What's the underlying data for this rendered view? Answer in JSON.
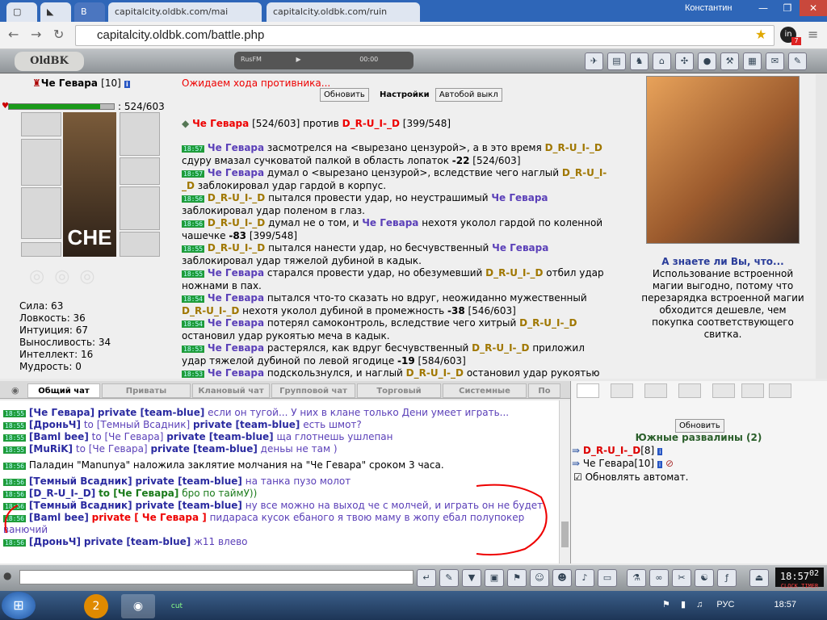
{
  "browser": {
    "tabs": [
      {
        "label": "capitalcity.oldbk.com/mai"
      },
      {
        "label": "capitalcity.oldbk.com/ruin"
      }
    ],
    "user": "Константин",
    "url": "capitalcity.oldbk.com/battle.php",
    "ext_badge": "7"
  },
  "gamebar": {
    "logo": "OldBK",
    "radio_label": "RusFM",
    "radio_time": "00:00"
  },
  "character": {
    "name": "Че Гевара",
    "level": "[10]",
    "hp": "524/603",
    "hp_fraction": 0.869,
    "photo_caption": "CHE",
    "stats": [
      "Сила: 63",
      "Ловкость: 36",
      "Интуиция: 67",
      "Выносливость: 34",
      "Интеллект: 16",
      "Мудрость: 0"
    ]
  },
  "battle": {
    "status": "Ожидаем хода противника...",
    "refresh": "Обновить",
    "settings": "Настройки",
    "autobattle": "Автобой выкл",
    "player1": "Че Гевара",
    "player1_hp": "[524/603]",
    "versus": "против",
    "player2": "D_R-U_I-_D",
    "player2_hp": "[399/548]",
    "log": [
      {
        "time": "18:57",
        "html": "<span class=p1>Че Гевара</span> засмотрелся на &lt;вырезано цензурой&gt;, а в это время <span class=p2>D_R-U_I-_D</span> сдуру вмазал сучковатой палкой в область лопаток <b>-22</b> [524/603]"
      },
      {
        "time": "18:57",
        "html": "<span class=p1>Че Гевара</span> думал о &lt;вырезано цензурой&gt;, вследствие чего наглый <span class=p2>D_R-U_I-_D</span> заблокировал удар гардой в корпус."
      },
      {
        "time": "18:56",
        "html": "<span class=p2>D_R-U_I-_D</span> пытался провести удар, но неустрашимый <span class=p1>Че Гевара</span> заблокировал удар поленом в глаз."
      },
      {
        "time": "18:56",
        "html": "<span class=p2>D_R-U_I-_D</span> думал не о том, и <span class=p1>Че Гевара</span> нехотя уколол гардой по коленной чашечке <b>-83</b> [399/548]"
      },
      {
        "time": "18:55",
        "html": "<span class=p2>D_R-U_I-_D</span> пытался нанести удар, но бесчувственный <span class=p1>Че Гевара</span> заблокировал удар тяжелой дубиной в кадык."
      },
      {
        "time": "18:55",
        "html": "<span class=p1>Че Гевара</span> старался провести удар, но обезумевший <span class=p2>D_R-U_I-_D</span> отбил удар ножнами в пах."
      },
      {
        "time": "18:54",
        "html": "<span class=p1>Че Гевара</span> пытался что-то сказать но вдруг, неожиданно мужественный <span class=p2>D_R-U_I-_D</span> нехотя уколол дубиной в промежность <b>-38</b> [546/603]"
      },
      {
        "time": "18:54",
        "html": "<span class=p1>Че Гевара</span> потерял самоконтроль, вследствие чего хитрый <span class=p2>D_R-U_I-_D</span> остановил удар рукоятью меча в кадык."
      },
      {
        "time": "18:53",
        "html": "<span class=p1>Че Гевара</span> растерялся, как вдруг бесчувственный <span class=p2>D_R-U_I-_D</span> приложил удар тяжелой дубиной по левой ягодице <b>-19</b> [584/603]"
      },
      {
        "time": "18:53",
        "html": "<span class=p1>Че Гевара</span> подскользнулся, и наглый <span class=p2>D_R-U_I-_D</span> остановил удар рукоятью меча по ногам."
      }
    ]
  },
  "tips": {
    "title": "А знаете ли Вы, что...",
    "text": "Использование встроенной магии выгодно, потому что перезарядка встроенной магии обходится дешевле, чем покупка соответствующего свитка."
  },
  "chat_tabs": [
    "Общий чат",
    "Приваты",
    "Клановый чат",
    "Групповой чат",
    "Торговый",
    "Системные",
    "По"
  ],
  "chat": [
    {
      "time": "18:55",
      "html": "<span class=nm>[Че Гевара]</span> <span class=pr>private [team-blue]</span> <span class=pv>если он тугой... У них в клане только Дени умеет играть...</span>"
    },
    {
      "time": "18:55",
      "html": "<span class=nm>[ДроньЧ]</span> <span class=pv>to [Темный Всадник]</span> <span class=pr>private [team-blue]</span> <span class=pv>есть шмот?</span>"
    },
    {
      "time": "18:55",
      "html": "<span class=nm>[Baml bee]</span> <span class=pv>to [Че Гевара]</span> <span class=pr>private [team-blue]</span> <span class=pv>ща глотнешь ушлепан</span>"
    },
    {
      "time": "18:55",
      "html": "<span class=nm>[MuRiK]</span> <span class=pv>to [Че Гевара]</span> <span class=pr>private [team-blue]</span> <span class=pv>деньы не там )</span>"
    },
    {
      "time": "18:56",
      "html": "Паладин \"Manunya\" наложила заклятие молчания на \"Че Гевара\" сроком 3 часа."
    },
    {
      "time": "18:56",
      "html": "<span class=nm>[Темный Всадник]</span> <span class=pr>private [team-blue]</span> <span class=pv>на танка пузо молот</span>"
    },
    {
      "time": "18:56",
      "html": "<span class=nm>[D_R-U_I-_D]</span> <span style='color:#1a7a1a;font-weight:bold'>to [Че Гевара]</span> <span style='color:#1a7a1a'>бро по таймУ))</span>"
    },
    {
      "time": "18:56",
      "html": "<span class=nm>[Темный Всадник]</span> <span class=pr>private [team-blue]</span> <span class=pv>ну все можно на выход че с молчей, и играть он не будет</span>"
    },
    {
      "time": "18:56",
      "html": "<span class=nm>[Baml bee]</span> <span style='color:#e00;font-weight:bold'>private [ Че Гевара ]</span> <span class=pv>пидараса кусок ебаного я твою маму в жопу ебал полупокер</span>"
    },
    {
      "time": "",
      "html": "<span class=pv>ванючий</span>"
    },
    {
      "time": "18:56",
      "html": "<span class=nm>[ДроньЧ]</span> <span class=pr>private [team-blue]</span> <span class=pv>ж11 влево</span>"
    }
  ],
  "online": {
    "refresh": "Обновить",
    "location": "Южные развалины (2)",
    "players": [
      {
        "name": "D_R-U_I-_D",
        "level": "[8]",
        "color": "#d00"
      },
      {
        "name": "Че Гевара",
        "level": "[10]",
        "color": "#000"
      }
    ],
    "auto_refresh": "Обновлять автомат."
  },
  "clock": {
    "time": "18:57",
    "seconds": "02",
    "label": "CLOCK TIMER"
  },
  "taskbar": {
    "lang": "РУС",
    "time": "18:57"
  }
}
